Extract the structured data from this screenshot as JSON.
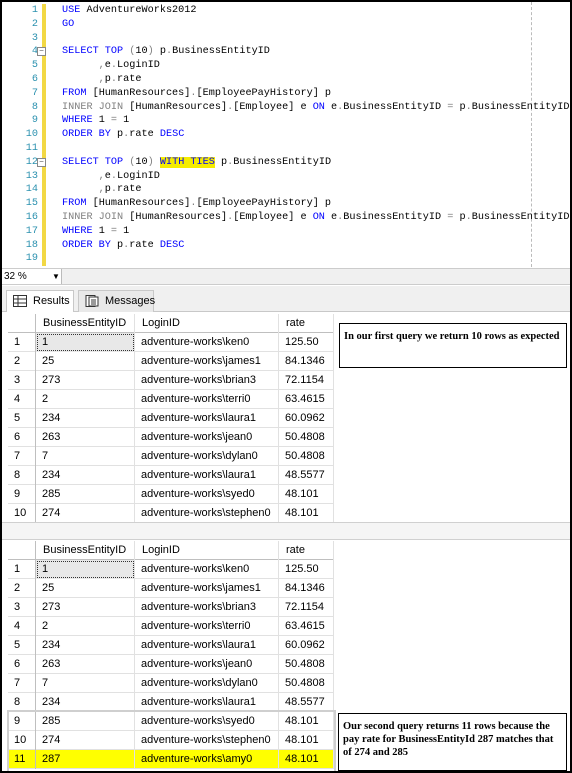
{
  "editor": {
    "lines": [
      {
        "n": "1",
        "segments": [
          {
            "t": "USE ",
            "c": "kw"
          },
          {
            "t": "AdventureWorks2012",
            "c": ""
          }
        ]
      },
      {
        "n": "2",
        "segments": [
          {
            "t": "GO",
            "c": "kw"
          }
        ]
      },
      {
        "n": "3",
        "segments": []
      },
      {
        "n": "4",
        "collapse": true,
        "segments": [
          {
            "t": "SELECT TOP ",
            "c": "kw"
          },
          {
            "t": "(",
            "c": "gray"
          },
          {
            "t": "10",
            "c": ""
          },
          {
            "t": ")",
            "c": "gray"
          },
          {
            "t": " p",
            "c": ""
          },
          {
            "t": ".",
            "c": "gray"
          },
          {
            "t": "BusinessEntityID",
            "c": ""
          }
        ]
      },
      {
        "n": "5",
        "segments": [
          {
            "t": "      ,",
            "c": "gray"
          },
          {
            "t": "e",
            "c": ""
          },
          {
            "t": ".",
            "c": "gray"
          },
          {
            "t": "LoginID",
            "c": ""
          }
        ]
      },
      {
        "n": "6",
        "segments": [
          {
            "t": "      ,",
            "c": "gray"
          },
          {
            "t": "p",
            "c": ""
          },
          {
            "t": ".",
            "c": "gray"
          },
          {
            "t": "rate",
            "c": ""
          }
        ]
      },
      {
        "n": "7",
        "segments": [
          {
            "t": "FROM ",
            "c": "kw"
          },
          {
            "t": "[HumanResources]",
            "c": ""
          },
          {
            "t": ".",
            "c": "gray"
          },
          {
            "t": "[EmployeePayHistory] p",
            "c": ""
          }
        ]
      },
      {
        "n": "8",
        "segments": [
          {
            "t": "INNER JOIN ",
            "c": "gray"
          },
          {
            "t": "[HumanResources]",
            "c": ""
          },
          {
            "t": ".",
            "c": "gray"
          },
          {
            "t": "[Employee] e ",
            "c": ""
          },
          {
            "t": "ON ",
            "c": "kw"
          },
          {
            "t": "e",
            "c": ""
          },
          {
            "t": ".",
            "c": "gray"
          },
          {
            "t": "BusinessEntityID ",
            "c": ""
          },
          {
            "t": "=",
            "c": "gray"
          },
          {
            "t": " p",
            "c": ""
          },
          {
            "t": ".",
            "c": "gray"
          },
          {
            "t": "BusinessEntityID",
            "c": ""
          }
        ]
      },
      {
        "n": "9",
        "segments": [
          {
            "t": "WHERE ",
            "c": "kw"
          },
          {
            "t": "1 ",
            "c": ""
          },
          {
            "t": "=",
            "c": "gray"
          },
          {
            "t": " 1",
            "c": ""
          }
        ]
      },
      {
        "n": "10",
        "segments": [
          {
            "t": "ORDER BY ",
            "c": "kw"
          },
          {
            "t": "p",
            "c": ""
          },
          {
            "t": ".",
            "c": "gray"
          },
          {
            "t": "rate ",
            "c": ""
          },
          {
            "t": "DESC",
            "c": "kw"
          }
        ]
      },
      {
        "n": "11",
        "segments": []
      },
      {
        "n": "12",
        "collapse": true,
        "segments": [
          {
            "t": "SELECT TOP ",
            "c": "kw"
          },
          {
            "t": "(",
            "c": "gray"
          },
          {
            "t": "10",
            "c": ""
          },
          {
            "t": ")",
            "c": "gray"
          },
          {
            "t": " ",
            "c": ""
          },
          {
            "t": "WITH TIES",
            "c": "kw hl"
          },
          {
            "t": " p",
            "c": ""
          },
          {
            "t": ".",
            "c": "gray"
          },
          {
            "t": "BusinessEntityID",
            "c": ""
          }
        ]
      },
      {
        "n": "13",
        "segments": [
          {
            "t": "      ,",
            "c": "gray"
          },
          {
            "t": "e",
            "c": ""
          },
          {
            "t": ".",
            "c": "gray"
          },
          {
            "t": "LoginID",
            "c": ""
          }
        ]
      },
      {
        "n": "14",
        "segments": [
          {
            "t": "      ,",
            "c": "gray"
          },
          {
            "t": "p",
            "c": ""
          },
          {
            "t": ".",
            "c": "gray"
          },
          {
            "t": "rate",
            "c": ""
          }
        ]
      },
      {
        "n": "15",
        "segments": [
          {
            "t": "FROM ",
            "c": "kw"
          },
          {
            "t": "[HumanResources]",
            "c": ""
          },
          {
            "t": ".",
            "c": "gray"
          },
          {
            "t": "[EmployeePayHistory] p",
            "c": ""
          }
        ]
      },
      {
        "n": "16",
        "segments": [
          {
            "t": "INNER JOIN ",
            "c": "gray"
          },
          {
            "t": "[HumanResources]",
            "c": ""
          },
          {
            "t": ".",
            "c": "gray"
          },
          {
            "t": "[Employee] e ",
            "c": ""
          },
          {
            "t": "ON ",
            "c": "kw"
          },
          {
            "t": "e",
            "c": ""
          },
          {
            "t": ".",
            "c": "gray"
          },
          {
            "t": "BusinessEntityID ",
            "c": ""
          },
          {
            "t": "=",
            "c": "gray"
          },
          {
            "t": " p",
            "c": ""
          },
          {
            "t": ".",
            "c": "gray"
          },
          {
            "t": "BusinessEntityID",
            "c": ""
          }
        ]
      },
      {
        "n": "17",
        "segments": [
          {
            "t": "WHERE ",
            "c": "kw"
          },
          {
            "t": "1 ",
            "c": ""
          },
          {
            "t": "=",
            "c": "gray"
          },
          {
            "t": " 1",
            "c": ""
          }
        ]
      },
      {
        "n": "18",
        "segments": [
          {
            "t": "ORDER BY ",
            "c": "kw"
          },
          {
            "t": "p",
            "c": ""
          },
          {
            "t": ".",
            "c": "gray"
          },
          {
            "t": "rate ",
            "c": ""
          },
          {
            "t": "DESC",
            "c": "kw"
          }
        ]
      },
      {
        "n": "19",
        "segments": []
      }
    ]
  },
  "zoom": {
    "value": "32 %"
  },
  "tabs": {
    "results": "Results",
    "messages": "Messages"
  },
  "grid1": {
    "headers": [
      "BusinessEntityID",
      "LoginID",
      "rate"
    ],
    "rows": [
      [
        "1",
        "1",
        "adventure-works\\ken0",
        "125.50"
      ],
      [
        "2",
        "25",
        "adventure-works\\james1",
        "84.1346"
      ],
      [
        "3",
        "273",
        "adventure-works\\brian3",
        "72.1154"
      ],
      [
        "4",
        "2",
        "adventure-works\\terri0",
        "63.4615"
      ],
      [
        "5",
        "234",
        "adventure-works\\laura1",
        "60.0962"
      ],
      [
        "6",
        "263",
        "adventure-works\\jean0",
        "50.4808"
      ],
      [
        "7",
        "7",
        "adventure-works\\dylan0",
        "50.4808"
      ],
      [
        "8",
        "234",
        "adventure-works\\laura1",
        "48.5577"
      ],
      [
        "9",
        "285",
        "adventure-works\\syed0",
        "48.101"
      ],
      [
        "10",
        "274",
        "adventure-works\\stephen0",
        "48.101"
      ]
    ]
  },
  "grid2": {
    "headers": [
      "BusinessEntityID",
      "LoginID",
      "rate"
    ],
    "rows": [
      [
        "1",
        "1",
        "adventure-works\\ken0",
        "125.50"
      ],
      [
        "2",
        "25",
        "adventure-works\\james1",
        "84.1346"
      ],
      [
        "3",
        "273",
        "adventure-works\\brian3",
        "72.1154"
      ],
      [
        "4",
        "2",
        "adventure-works\\terri0",
        "63.4615"
      ],
      [
        "5",
        "234",
        "adventure-works\\laura1",
        "60.0962"
      ],
      [
        "6",
        "263",
        "adventure-works\\jean0",
        "50.4808"
      ],
      [
        "7",
        "7",
        "adventure-works\\dylan0",
        "50.4808"
      ],
      [
        "8",
        "234",
        "adventure-works\\laura1",
        "48.5577"
      ],
      [
        "9",
        "285",
        "adventure-works\\syed0",
        "48.101"
      ],
      [
        "10",
        "274",
        "adventure-works\\stephen0",
        "48.101"
      ],
      [
        "11",
        "287",
        "adventure-works\\amy0",
        "48.101"
      ]
    ],
    "highlight_row": "11"
  },
  "notes": {
    "first": "In our first query we return 10 rows as expected",
    "second": "Our second query returns 11 rows because the pay rate for BusinessEntityId 287 matches that of 274 and 285"
  },
  "colors": {
    "keyword": "#0000ff",
    "highlight": "#ffff00",
    "line_number": "#2b91af"
  }
}
